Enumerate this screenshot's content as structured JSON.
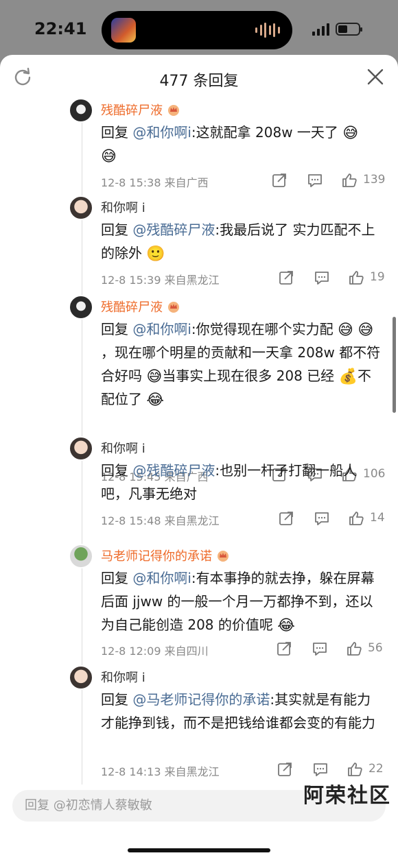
{
  "status_bar": {
    "time": "22:41"
  },
  "header": {
    "title": "477 条回复"
  },
  "comments": [
    {
      "name": "残酷碎尸液",
      "reply_prefix": "回复",
      "mention": "@和你啊i",
      "text": ":这就配拿 208w 一天了",
      "text_b": "",
      "date": "12-8 15:38",
      "location": "来自广西",
      "likes": "139"
    },
    {
      "name": "和你啊 i",
      "reply_prefix": "回复",
      "mention": "@残酷碎尸液",
      "text": ":我最后说了 实力匹配不上的除外",
      "text_b": "",
      "date": "12-8 15:39",
      "location": "来自黑龙江",
      "likes": "19"
    },
    {
      "name": "残酷碎尸液",
      "reply_prefix": "回复",
      "mention": "@和你啊i",
      "text": ":你觉得现在哪个实力配",
      "text_b": "，现在哪个明星的贡献和一天拿 208w 都不符合好吗",
      "text_c": "当事实上现在很多 208 已经",
      "text_d": "不配位了",
      "date": "12-8 15:45",
      "location": "来自广西",
      "likes": "106"
    },
    {
      "name": "和你啊 i",
      "reply_prefix": "回复",
      "mention": "@残酷碎尸液",
      "text": ":也别一杆子打翻一船人吧，凡事无绝对",
      "text_b": "",
      "date": "12-8 15:48",
      "location": "来自黑龙江",
      "likes": "14"
    },
    {
      "name": "马老师记得你的承诺",
      "reply_prefix": "回复",
      "mention": "@和你啊i",
      "text": ":有本事挣的就去挣，躲在屏幕后面 jjww 的一般一个月一万都挣不到，还以为自己能创造 208 的价值呢",
      "text_b": "",
      "date": "12-8 12:09",
      "location": "来自四川",
      "likes": "56"
    },
    {
      "name": "和你啊 i",
      "reply_prefix": "回复",
      "mention": "@马老师记得你的承诺",
      "text": ":其实就是有能力才能挣到钱，而不是把钱给谁都会变的有能力",
      "text_b": "",
      "date": "12-8 14:13",
      "location": "来自黑龙江",
      "likes": "22"
    }
  ],
  "input": {
    "placeholder": "回复 @初恋情人蔡敏敏"
  },
  "watermark": "阿荣社区"
}
